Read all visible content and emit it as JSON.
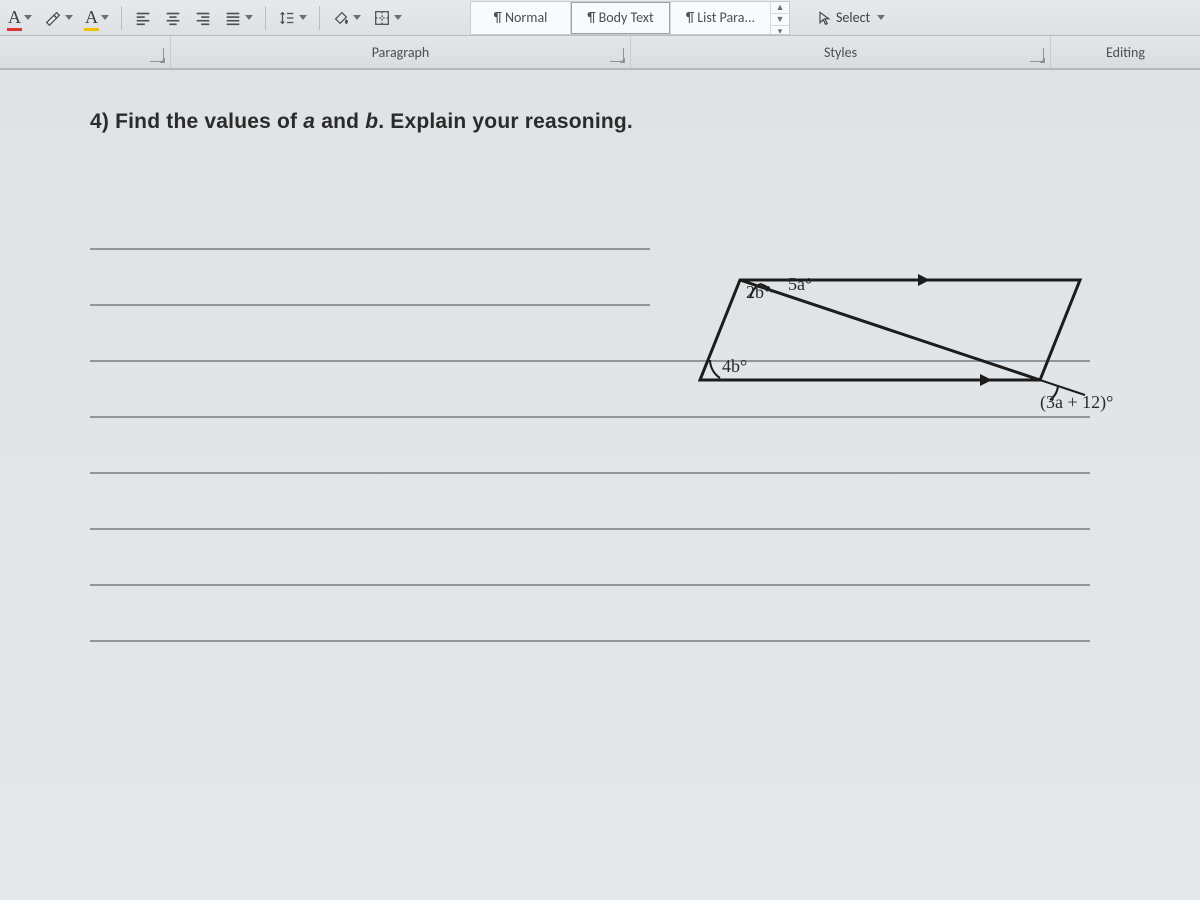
{
  "ribbon": {
    "font_color_letter": "A",
    "highlight_letter": "A",
    "styles": {
      "items": [
        {
          "label": "¶ Normal"
        },
        {
          "label": "¶ Body Text"
        },
        {
          "label": "¶ List Para..."
        }
      ]
    },
    "select_label": "Select"
  },
  "groups": {
    "paragraph": "Paragraph",
    "styles": "Styles",
    "editing": "Editing"
  },
  "document": {
    "question_number": "4)",
    "question_text_a": "Find the values of ",
    "question_var1": "a",
    "question_text_b": " and ",
    "question_var2": "b",
    "question_text_c": ". Explain your reasoning."
  },
  "figure": {
    "label_2b": "2b°",
    "label_5a": "5a°",
    "label_4b": "4b°",
    "label_3a12": "(3a + 12)°"
  }
}
